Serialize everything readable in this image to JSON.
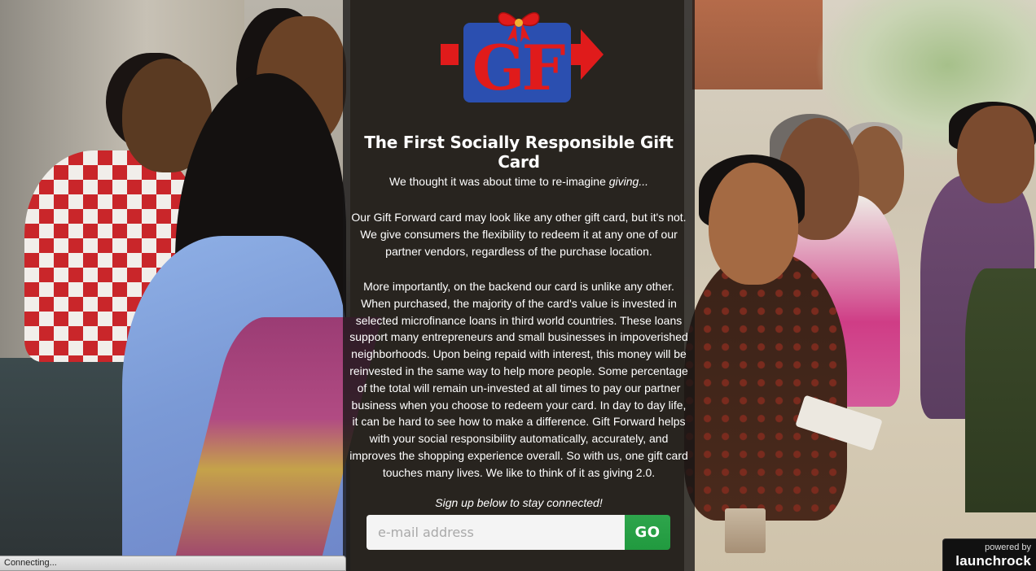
{
  "logo": {
    "letters": "GF",
    "colors": {
      "box": "#2b4fb0",
      "letters": "#e01b1b",
      "ribbon": "#e01b1b",
      "arrow": "#e01b1b"
    }
  },
  "panel": {
    "heading": "The First Socially Responsible Gift Card",
    "intro_plain": "We thought it was about time to re-imagine ",
    "intro_italic": "giving...",
    "paragraph1": "Our Gift Forward card may look like any other gift card, but it's not. We give consumers the flexibility to redeem it at any one of our partner vendors, regardless of the purchase location.",
    "paragraph2": "More importantly, on the backend our card is unlike any other. When purchased, the majority of the card's value is invested in selected microfinance loans in third world countries. These loans support many entrepreneurs and small businesses in impoverished neighborhoods. Upon being repaid with interest, this money will be reinvested in the same way to help more people. Some percentage of the total will remain un-invested at all times to pay our partner business when you choose to redeem your card. In day to day life, it can be hard to see how to make a difference. Gift Forward helps with your social responsibility automatically, accurately, and improves the shopping experience overall. So with us, one gift card touches many lives. We like to think of it as giving 2.0.",
    "signup_prompt": "Sign up below to stay connected!",
    "email": {
      "placeholder": "e-mail address",
      "value": ""
    },
    "go_label": "GO"
  },
  "status_bar": {
    "text": "Connecting..."
  },
  "powered_badge": {
    "top": "powered by",
    "brand": "launchrock"
  },
  "colors": {
    "panel_overlay": "#161414",
    "go_button": "#27a044",
    "status_bar": "#dcdcdc"
  }
}
